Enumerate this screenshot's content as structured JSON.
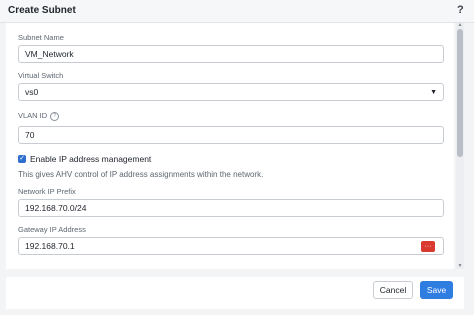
{
  "dialog": {
    "title": "Create Subnet",
    "help_label": "?"
  },
  "form": {
    "subnet_name": {
      "label": "Subnet Name",
      "value": "VM_Network"
    },
    "virtual_switch": {
      "label": "Virtual Switch",
      "value": "vs0"
    },
    "vlan_id": {
      "label": "VLAN ID",
      "info_icon": "?",
      "value": "70"
    },
    "ip_management": {
      "label": "Enable IP address management",
      "checked": true,
      "description": "This gives AHV control of IP address assignments within the network."
    },
    "network_ip_prefix": {
      "label": "Network IP Prefix",
      "value": "192.168.70.0/24"
    },
    "gateway_ip": {
      "label": "Gateway IP Address",
      "value": "192.168.70.1",
      "more_label": "···"
    }
  },
  "footer": {
    "cancel_label": "Cancel",
    "save_label": "Save"
  },
  "colors": {
    "primary": "#2f7de1",
    "checkbox": "#2f6fd0",
    "danger": "#d93a2f"
  }
}
